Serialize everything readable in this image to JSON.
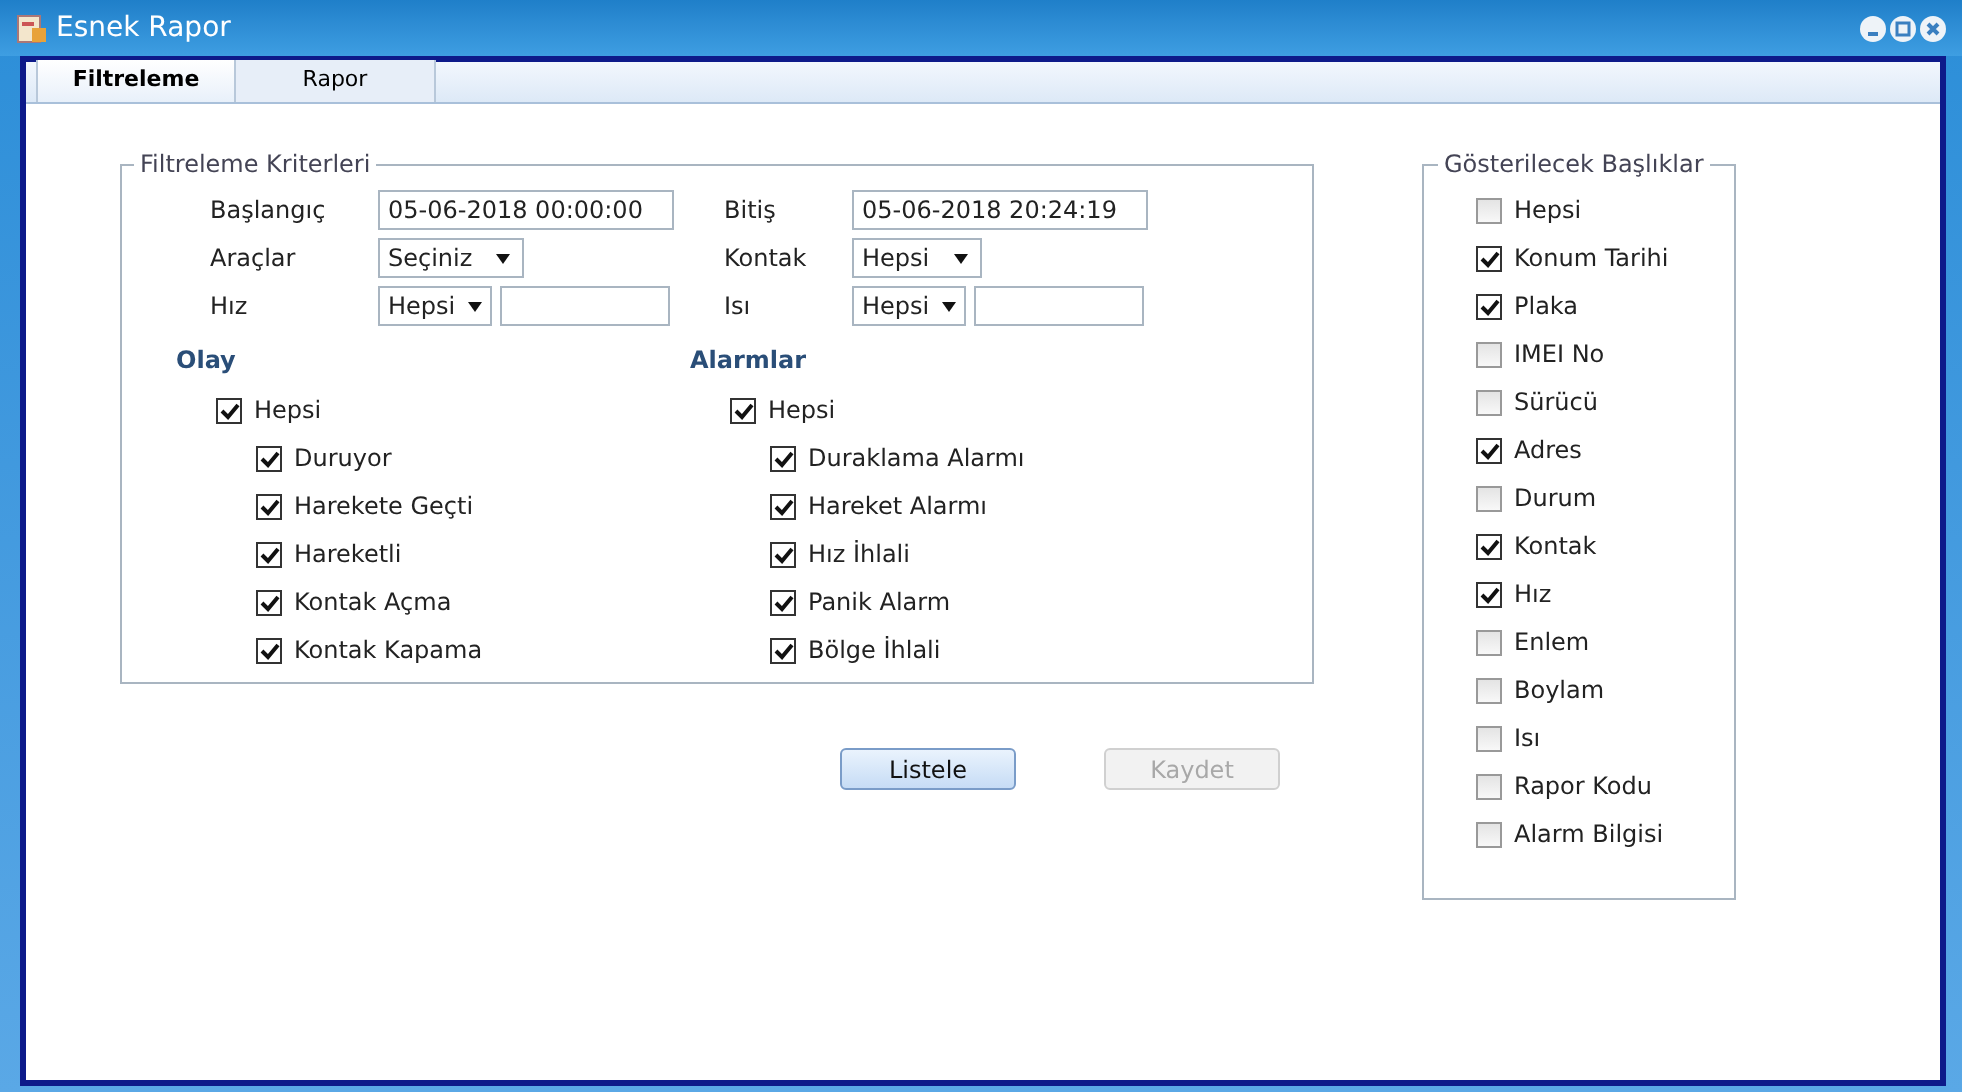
{
  "window": {
    "title": "Esnek Rapor"
  },
  "tabs": [
    {
      "label": "Filtreleme",
      "selected": true
    },
    {
      "label": "Rapor",
      "selected": false
    }
  ],
  "filter_criteria": {
    "legend": "Filtreleme Kriterleri",
    "fields": [
      {
        "label": "Başlangıç",
        "kind": "text",
        "value": "05-06-2018 00:00:00"
      },
      {
        "label": "Bitiş",
        "kind": "text",
        "value": "05-06-2018 20:24:19"
      },
      {
        "label": "Araçlar",
        "kind": "select",
        "value": "Seçiniz"
      },
      {
        "label": "Kontak",
        "kind": "select",
        "value": "Hepsi"
      },
      {
        "label": "Hız",
        "kind": "select_text",
        "value": "Hepsi"
      },
      {
        "label": "Isı",
        "kind": "select_text",
        "value": "Hepsi"
      }
    ],
    "groups": [
      {
        "title": "Olay",
        "all": {
          "label": "Hepsi",
          "checked": true
        },
        "items": [
          {
            "label": "Duruyor",
            "checked": true
          },
          {
            "label": "Harekete Geçti",
            "checked": true
          },
          {
            "label": "Hareketli",
            "checked": true
          },
          {
            "label": "Kontak Açma",
            "checked": true
          },
          {
            "label": "Kontak Kapama",
            "checked": true
          }
        ]
      },
      {
        "title": "Alarmlar",
        "all": {
          "label": "Hepsi",
          "checked": true
        },
        "items": [
          {
            "label": "Duraklama Alarmı",
            "checked": true
          },
          {
            "label": "Hareket Alarmı",
            "checked": true
          },
          {
            "label": "Hız İhlali",
            "checked": true
          },
          {
            "label": "Panik Alarm",
            "checked": true
          },
          {
            "label": "Bölge İhlali",
            "checked": true
          }
        ]
      }
    ]
  },
  "buttons": [
    {
      "label": "Listele",
      "disabled": false
    },
    {
      "label": "Kaydet",
      "disabled": true
    }
  ],
  "columns_panel": {
    "legend": "Gösterilecek Başlıklar",
    "items": [
      {
        "label": "Hepsi",
        "checked": false
      },
      {
        "label": "Konum Tarihi",
        "checked": true
      },
      {
        "label": "Plaka",
        "checked": true
      },
      {
        "label": "IMEI No",
        "checked": false
      },
      {
        "label": "Sürücü",
        "checked": false
      },
      {
        "label": "Adres",
        "checked": true
      },
      {
        "label": "Durum",
        "checked": false
      },
      {
        "label": "Kontak",
        "checked": true
      },
      {
        "label": "Hız",
        "checked": true
      },
      {
        "label": "Enlem",
        "checked": false
      },
      {
        "label": "Boylam",
        "checked": false
      },
      {
        "label": "Isı",
        "checked": false
      },
      {
        "label": "Rapor Kodu",
        "checked": false
      },
      {
        "label": "Alarm Bilgisi",
        "checked": false
      }
    ]
  }
}
